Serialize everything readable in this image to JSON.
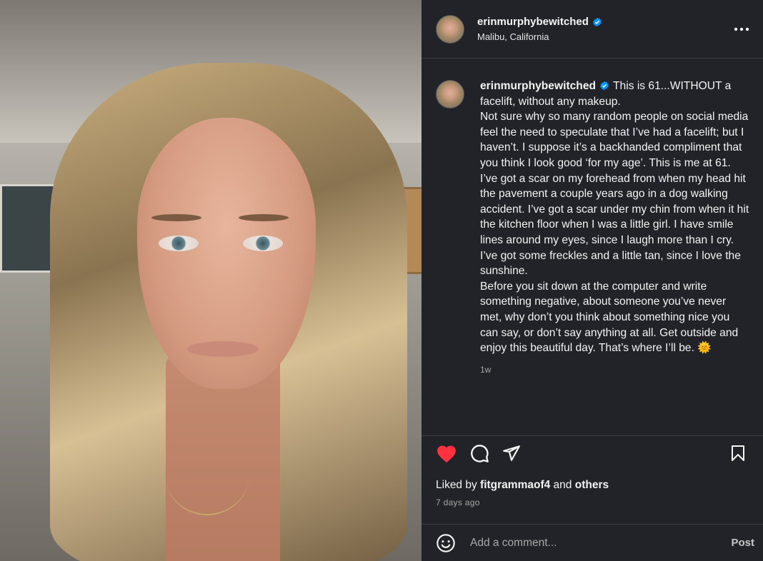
{
  "post": {
    "username": "erinmurphybewitched",
    "location": "Malibu, California",
    "caption": "This is 61...WITHOUT a facelift, without any makeup.\nNot sure why so many random people on social media feel the need to speculate that I’ve had a facelift; but I haven’t. I suppose it’s a backhanded compliment that you think I look good ‘for my age’. This is me at 61. I’ve got a scar on my forehead from when my head hit the pavement a couple years ago in a dog walking accident. I’ve got a scar under my chin from when it hit the kitchen floor when I was a little girl. I have smile lines around my eyes, since I laugh more than I cry. I’ve got some freckles and a little tan, since I love the sunshine.\nBefore you sit down at the computer and write something negative, about someone you’ve never met, why don’t you think about something nice you can say, or don’t say anything at all. Get outside and enjoy this beautiful day. That’s where I’ll be.",
    "emoji": "🌞",
    "caption_time": "1w",
    "liked_by_prefix": "Liked by",
    "liked_by_user": "fitgrammaof4",
    "liked_by_and": "and",
    "liked_by_others": "others",
    "posted_ago": "7 days ago"
  },
  "comment": {
    "placeholder": "Add a comment...",
    "post_label": "Post"
  },
  "icons": {
    "verified": "verified-badge-icon",
    "more": "more-options-icon",
    "like": "heart-icon",
    "comment": "comment-icon",
    "share": "share-icon",
    "save": "bookmark-icon",
    "emoji": "emoji-icon"
  },
  "colors": {
    "panel_bg": "#212328",
    "like_red": "#ff3040",
    "verified_blue": "#0095f6",
    "muted_text": "#a8a8a8"
  }
}
